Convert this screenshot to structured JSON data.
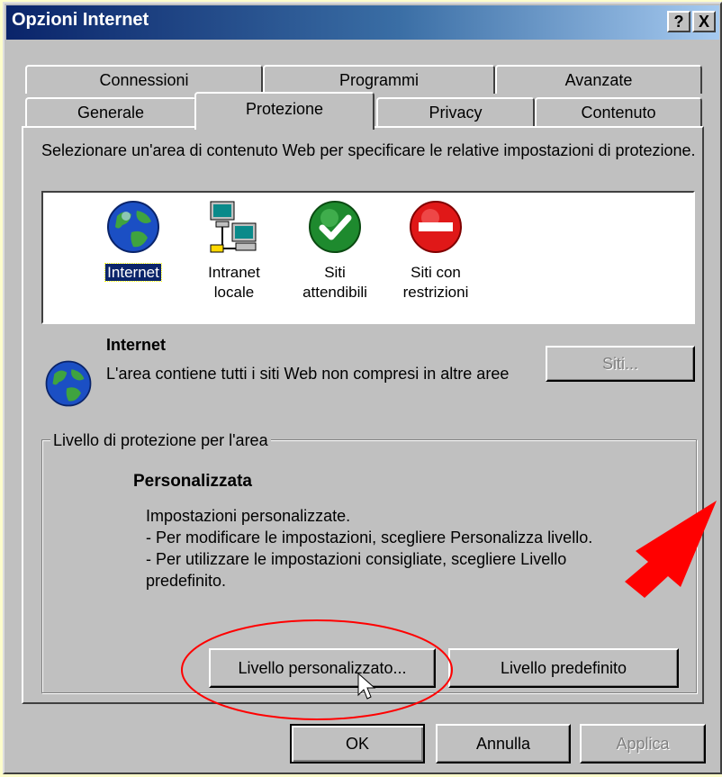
{
  "window": {
    "title": "Opzioni Internet",
    "help_label": "?",
    "close_label": "X"
  },
  "tabs_row1": [
    {
      "label": "Connessioni"
    },
    {
      "label": "Programmi"
    },
    {
      "label": "Avanzate"
    }
  ],
  "tabs_row2": [
    {
      "label": "Generale"
    },
    {
      "label": "Protezione",
      "active": true
    },
    {
      "label": "Privacy"
    },
    {
      "label": "Contenuto"
    }
  ],
  "instruction": "Selezionare un'area di contenuto Web per specificare le relative impostazioni di protezione.",
  "zones": [
    {
      "line1": "Internet",
      "line2": "",
      "icon": "globe-icon",
      "selected": true
    },
    {
      "line1": "Intranet",
      "line2": "locale",
      "icon": "network-computers-icon"
    },
    {
      "line1": "Siti",
      "line2": "attendibili",
      "icon": "green-check-icon"
    },
    {
      "line1": "Siti con",
      "line2": "restrizioni",
      "icon": "red-no-entry-icon"
    }
  ],
  "zone_info": {
    "title": "Internet",
    "description": "L'area contiene tutti i siti Web non compresi in altre aree",
    "sites_button": "Siti..."
  },
  "security_level": {
    "group_label": "Livello di protezione per l'area",
    "level_name": "Personalizzata",
    "desc_line1": "Impostazioni personalizzate.",
    "desc_line2": "- Per modificare le impostazioni, scegliere Personalizza livello.",
    "desc_line3": "- Per utilizzare le impostazioni consigliate, scegliere Livello",
    "desc_line4": "predefinito.",
    "custom_button": "Livello personalizzato...",
    "default_button": "Livello predefinito"
  },
  "footer": {
    "ok": "OK",
    "cancel": "Annulla",
    "apply": "Applica"
  },
  "colors": {
    "face": "#c0c0c0",
    "title_start": "#0a246a",
    "annotation_red": "#ff0000",
    "background": "#fdfdcb"
  }
}
